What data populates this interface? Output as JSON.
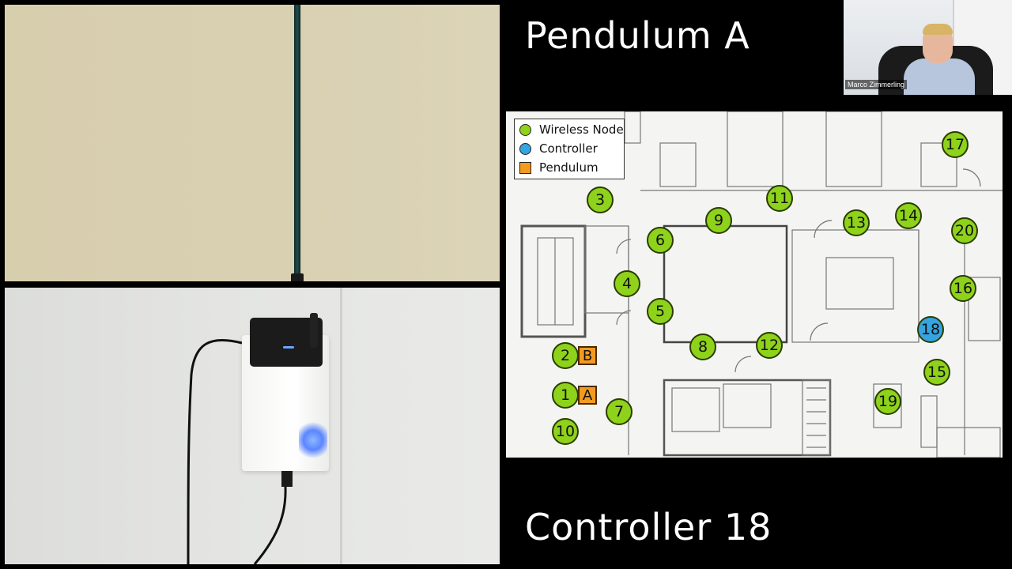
{
  "titles": {
    "top": "Pendulum A",
    "bottom": "Controller 18"
  },
  "webcam": {
    "participant_name": "Marco Zimmerling"
  },
  "legend": {
    "items": [
      {
        "label": "Wireless Node",
        "shape": "circle",
        "color": "#8ed21b"
      },
      {
        "label": "Controller",
        "shape": "circle",
        "color": "#35a4df"
      },
      {
        "label": "Pendulum",
        "shape": "square",
        "color": "#f39b20"
      }
    ]
  },
  "nodes": [
    "3",
    "11",
    "9",
    "13",
    "14",
    "17",
    "20",
    "6",
    "4",
    "5",
    "8",
    "12",
    "16",
    "18",
    "15",
    "19",
    "2",
    "1",
    "7",
    "10"
  ],
  "controller_node": "18",
  "pendulums": [
    "B",
    "A"
  ],
  "colors": {
    "wireless": "#8ed21b",
    "controller": "#35a4df",
    "pendulum": "#f39b20"
  }
}
